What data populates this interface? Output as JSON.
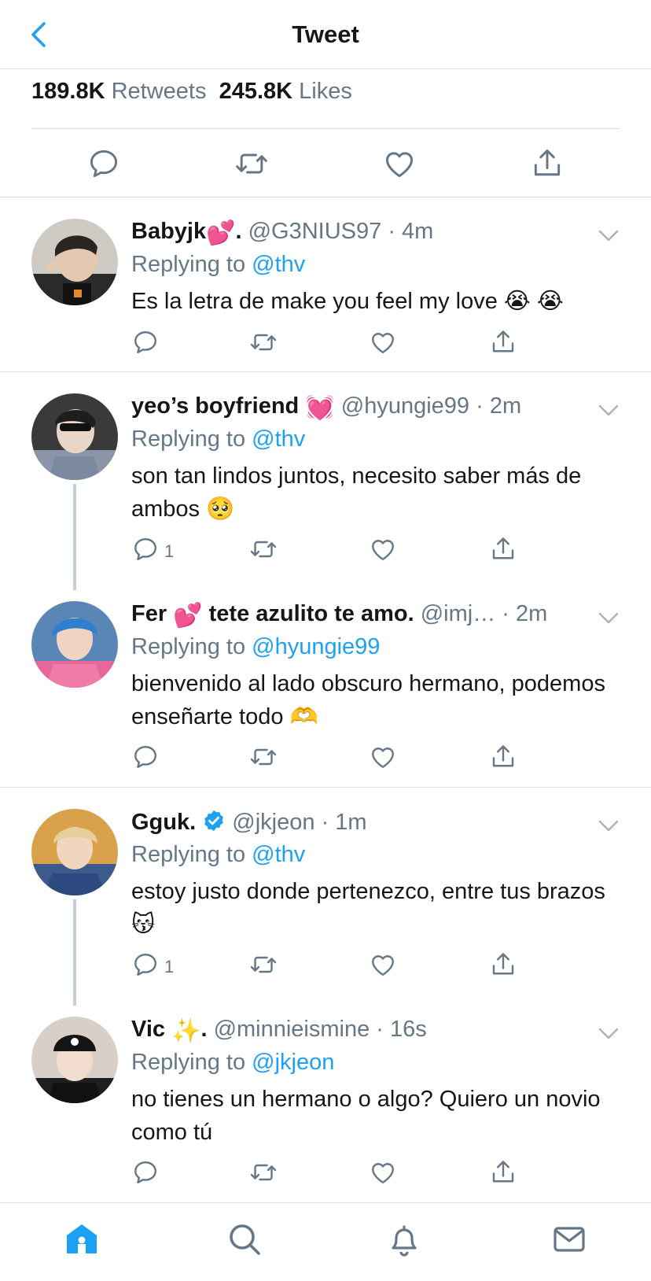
{
  "header": {
    "title": "Tweet",
    "back_icon": "chevron-left-icon"
  },
  "stats": {
    "retweets_count": "189.8K",
    "retweets_label": "Retweets",
    "likes_count": "245.8K",
    "likes_label": "Likes"
  },
  "colors": {
    "accent": "#1da1f2",
    "secondary_text": "#657786",
    "divider": "#d9dde1",
    "thread_line": "#c4cfd6"
  },
  "replies": [
    {
      "display_name": "Babyjk",
      "name_emoji": "💕",
      "name_suffix": ".",
      "handle": "@G3NIUS97",
      "time": "4m",
      "replying_label": "Replying to",
      "replying_to": "@thv",
      "text": "Es la letra de make you feel my love 😭 😭",
      "reply_count": ""
    },
    {
      "display_name": "yeo’s boyfriend",
      "name_emoji": "💓",
      "name_suffix": "",
      "handle": "@hyungie99",
      "time": "2m",
      "replying_label": "Replying to",
      "replying_to": "@thv",
      "text": "son tan lindos juntos, necesito saber más de ambos 🥺",
      "reply_count": "1"
    },
    {
      "display_name": "Fer",
      "name_emoji": "💕",
      "name_suffix": "tete azulito te amo.",
      "handle": "@imj…",
      "time": "2m",
      "replying_label": "Replying to",
      "replying_to": "@hyungie99",
      "text": "bienvenido al lado obscuro hermano, podemos enseñarte todo 🫶",
      "reply_count": ""
    },
    {
      "display_name": "Gguk.",
      "name_emoji": "",
      "name_suffix": "",
      "handle": "@jkjeon",
      "time": "1m",
      "replying_label": "Replying to",
      "replying_to": "@thv",
      "text": "estoy justo donde pertenezco, entre tus brazos 😽",
      "reply_count": "1",
      "verified": true
    },
    {
      "display_name": "Vic",
      "name_emoji": "✨",
      "name_suffix": ".",
      "handle": "@minnieismine",
      "time": "16s",
      "replying_label": "Replying to",
      "replying_to": "@jkjeon",
      "text": "no tienes un hermano o algo? Quiero un novio como tú",
      "reply_count": ""
    }
  ],
  "tabbar": {
    "items": [
      "home-icon",
      "search-icon",
      "notifications-icon",
      "messages-icon"
    ],
    "active": "home-icon"
  }
}
